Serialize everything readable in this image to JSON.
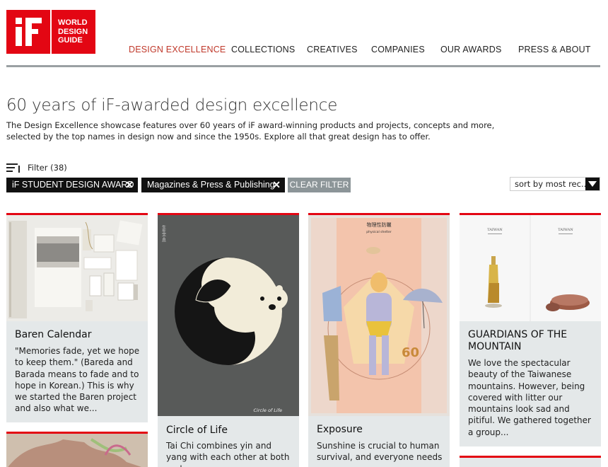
{
  "logo": {
    "line1": "WORLD",
    "line2": "DESIGN",
    "line3": "GUIDE"
  },
  "nav": [
    {
      "label": "DESIGN EXCELLENCE",
      "active": true
    },
    {
      "label": "COLLECTIONS"
    },
    {
      "label": "CREATIVES"
    },
    {
      "label": "COMPANIES"
    },
    {
      "label": "OUR AWARDS"
    },
    {
      "label": "PRESS & ABOUT"
    }
  ],
  "page": {
    "title": "60 years of iF-awarded design excellence",
    "intro": "The Design Excellence showcase features over 60 years of iF award-winning products and projects, concepts and more, selected by the top names in design now and since the 1950s. Explore all that great design has to offer."
  },
  "filter": {
    "label": "Filter (38)",
    "chips": [
      "iF STUDENT DESIGN AWARD",
      "Magazines & Press & Publishing"
    ],
    "chip_close": "✕",
    "clear_label": "CLEAR FILTER"
  },
  "sort": {
    "label": "sort by most rec..."
  },
  "cards": [
    {
      "title": "Baren Calendar",
      "desc": "\"Memories fade, yet we hope to keep them.\" (Bareda and Barada means to fade and to hope in Korean.) This is why we started the Baren project and also what we..."
    },
    {
      "title": "Circle of Life",
      "desc": "Tai Chi combines yin and yang with each other at both ends",
      "poster_caption": "Circle of Life",
      "poster_vertical": "生生不息"
    },
    {
      "title": "Exposure",
      "desc": "Sunshine is crucial to human survival, and everyone needs a",
      "poster_title_cn": "物理性防曬",
      "poster_title_en": "physical shelter",
      "poster_number": "60"
    },
    {
      "title": "GUARDIANS OF THE MOUNTAIN",
      "desc": "We love the spectacular beauty of the Taiwanese mountains. However, being covered with litter our mountains look sad and pitiful. We gathered together a group...",
      "poster_left": "TAIWAN",
      "poster_right": "TAIWAN"
    }
  ],
  "colors": {
    "brand": "#e30613",
    "active_nav": "#c0392b",
    "card_bg": "#e4e8e9",
    "clear_filter": "#8c9598"
  }
}
